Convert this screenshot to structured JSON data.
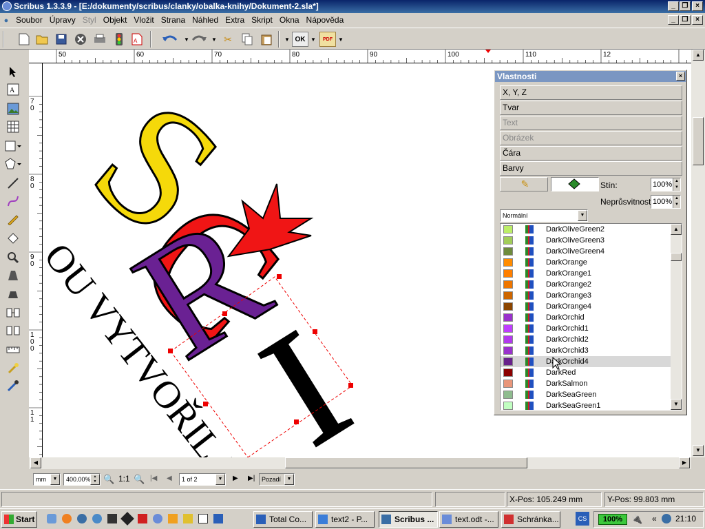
{
  "window": {
    "title": "Scribus 1.3.3.9 - [E:/dokumenty/scribus/clanky/obalka-knihy/Dokument-2.sla*]"
  },
  "menu": [
    {
      "label": "Soubor",
      "enabled": true
    },
    {
      "label": "Úpravy",
      "enabled": true
    },
    {
      "label": "Styl",
      "enabled": false
    },
    {
      "label": "Objekt",
      "enabled": true
    },
    {
      "label": "Vložit",
      "enabled": true
    },
    {
      "label": "Strana",
      "enabled": true
    },
    {
      "label": "Náhled",
      "enabled": true
    },
    {
      "label": "Extra",
      "enabled": true
    },
    {
      "label": "Skript",
      "enabled": true
    },
    {
      "label": "Okna",
      "enabled": true
    },
    {
      "label": "Nápověda",
      "enabled": true
    }
  ],
  "toolbar": {
    "ok_label": "OK",
    "pdf_label": "PDF"
  },
  "ruler": {
    "h_labels": [
      "50",
      "60",
      "70",
      "80",
      "90",
      "100",
      "110",
      "12"
    ],
    "v_labels": [
      "7\n0",
      "8\n0",
      "9\n0",
      "1\n0\n0",
      "1\n1"
    ]
  },
  "canvas": {
    "letters": [
      {
        "char": "S",
        "color": "#f5d90a"
      },
      {
        "char": "C",
        "color": "#f01515"
      },
      {
        "char": "R",
        "color": "#6a2193"
      },
      {
        "char": "I",
        "color": "#000000"
      }
    ],
    "tagline": "OU VYTVOŘIL JE"
  },
  "properties": {
    "title": "Vlastnosti",
    "sections": [
      {
        "label": "X, Y, Z",
        "enabled": true
      },
      {
        "label": "Tvar",
        "enabled": true
      },
      {
        "label": "Text",
        "enabled": false
      },
      {
        "label": "Obrázek",
        "enabled": false
      },
      {
        "label": "Čára",
        "enabled": true
      },
      {
        "label": "Barvy",
        "enabled": true
      }
    ],
    "shade_label": "Stín:",
    "shade_value": "100%",
    "opacity_label": "Neprůsvitnost:",
    "opacity_value": "100%",
    "blend_mode": "Normální",
    "colors": [
      {
        "name": "DarkOliveGreen2",
        "hex": "#bcee68"
      },
      {
        "name": "DarkOliveGreen3",
        "hex": "#a2cd5a"
      },
      {
        "name": "DarkOliveGreen4",
        "hex": "#6e8b3d"
      },
      {
        "name": "DarkOrange",
        "hex": "#ff8c00"
      },
      {
        "name": "DarkOrange1",
        "hex": "#ff7f00"
      },
      {
        "name": "DarkOrange2",
        "hex": "#ee7600"
      },
      {
        "name": "DarkOrange3",
        "hex": "#cd6600"
      },
      {
        "name": "DarkOrange4",
        "hex": "#8b4500"
      },
      {
        "name": "DarkOrchid",
        "hex": "#9932cc"
      },
      {
        "name": "DarkOrchid1",
        "hex": "#bf3eff"
      },
      {
        "name": "DarkOrchid2",
        "hex": "#b23aee"
      },
      {
        "name": "DarkOrchid3",
        "hex": "#9a32cd"
      },
      {
        "name": "DarkOrchid4",
        "hex": "#68228b",
        "selected": true
      },
      {
        "name": "DarkRed",
        "hex": "#8b0000"
      },
      {
        "name": "DarkSalmon",
        "hex": "#e9967a"
      },
      {
        "name": "DarkSeaGreen",
        "hex": "#8fbc8f"
      },
      {
        "name": "DarkSeaGreen1",
        "hex": "#c1ffc1"
      }
    ]
  },
  "view": {
    "unit": "mm",
    "zoom": "400.00%",
    "zoom_ratio": "1:1",
    "page": "1 of 2",
    "preview_mode": "Pozadí"
  },
  "status": {
    "xpos_label": "X-Pos:",
    "xpos_value": "105.249 mm",
    "ypos_label": "Y-Pos:",
    "ypos_value": "99.803 mm"
  },
  "taskbar": {
    "start_label": "Start",
    "tasks": [
      {
        "label": "Total Co...",
        "icon_color": "#2a5fb8",
        "active": false
      },
      {
        "label": "text2 - P...",
        "icon_color": "#3b7dd8",
        "active": false
      },
      {
        "label": "Scribus ...",
        "icon_color": "#3a6ea5",
        "active": true
      },
      {
        "label": "text.odt -...",
        "icon_color": "#6a8cd8",
        "active": false
      },
      {
        "label": "Schránka...",
        "icon_color": "#d03030",
        "active": false
      }
    ],
    "cs_label": "CS",
    "battery": "100%",
    "clock": "21:10"
  }
}
